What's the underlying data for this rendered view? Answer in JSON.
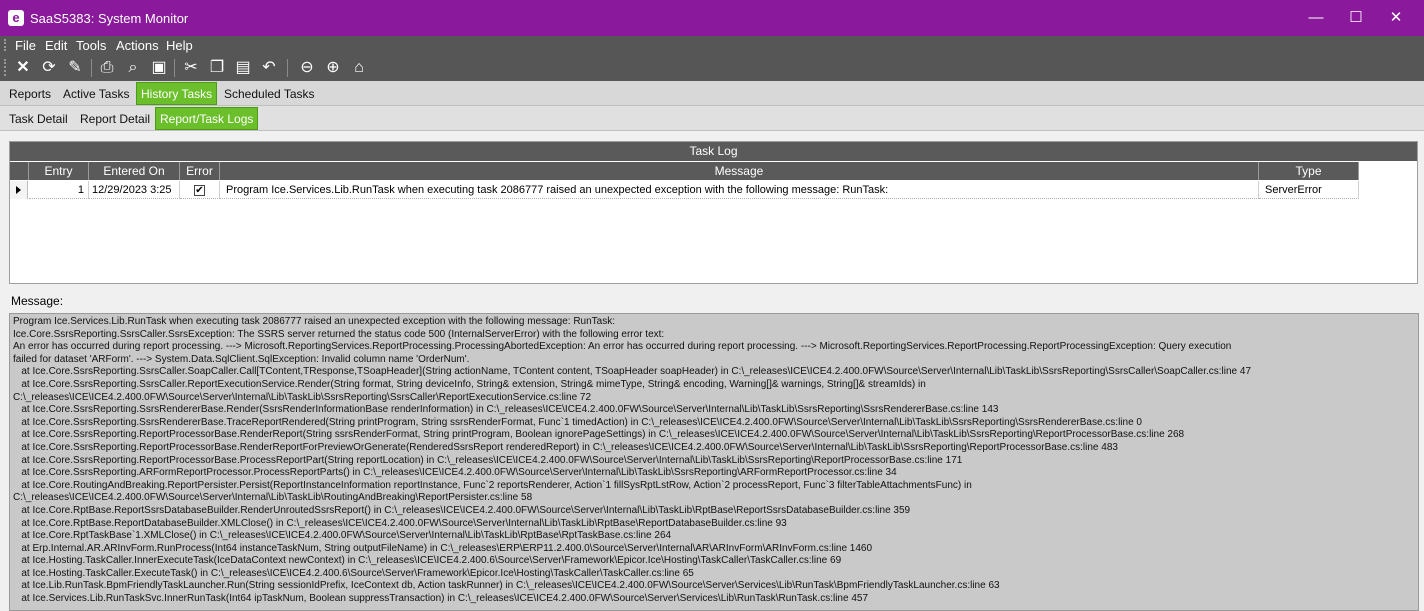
{
  "window": {
    "title": "SaaS5383: System Monitor",
    "app_icon_letter": "e",
    "controls": [
      "—",
      "☐",
      "✕"
    ]
  },
  "menu": [
    "File",
    "Edit",
    "Tools",
    "Actions",
    "Help"
  ],
  "toolbar_icons": [
    "clear-icon",
    "refresh-icon",
    "brush-icon",
    "print-icon",
    "preview-icon",
    "save-icon",
    "cut-icon",
    "copy-icon",
    "paste-icon",
    "undo-icon",
    "back-icon",
    "forward-icon",
    "home-icon"
  ],
  "tabs": {
    "main": [
      "Reports",
      "Active Tasks",
      "History Tasks",
      "Scheduled Tasks"
    ],
    "main_active": "History Tasks",
    "sub": [
      "Task Detail",
      "Report Detail",
      "Report/Task Logs"
    ],
    "sub_active": "Report/Task Logs"
  },
  "grid": {
    "caption": "Task Log",
    "columns": [
      "Entry",
      "Entered On",
      "Error",
      "Message",
      "Type"
    ],
    "rows": [
      {
        "entry": "1",
        "entered_on": "12/29/2023 3:25",
        "error": true,
        "message": "Program Ice.Services.Lib.RunTask when executing task 2086777 raised an unexpected exception with the following message: RunTask:",
        "type": "ServerError"
      }
    ]
  },
  "message_label": "Message:",
  "message_lines": [
    "Program Ice.Services.Lib.RunTask when executing task 2086777 raised an unexpected exception with the following message: RunTask:",
    "Ice.Core.SsrsReporting.SsrsCaller.SsrsException: The SSRS server returned the status code 500 (InternalServerError) with the following error text:",
    "An error has occurred during report processing. ---> Microsoft.ReportingServices.ReportProcessing.ProcessingAbortedException: An error has occurred during report processing. ---> Microsoft.ReportingServices.ReportProcessing.ReportProcessingException: Query execution",
    "failed for dataset 'ARForm'. ---> System.Data.SqlClient.SqlException: Invalid column name 'OrderNum'.",
    "   at Ice.Core.SsrsReporting.SsrsCaller.SoapCaller.Call[TContent,TResponse,TSoapHeader](String actionName, TContent content, TSoapHeader soapHeader) in C:\\_releases\\ICE\\ICE4.2.400.0FW\\Source\\Server\\Internal\\Lib\\TaskLib\\SsrsReporting\\SsrsCaller\\SoapCaller.cs:line 47",
    "   at Ice.Core.SsrsReporting.SsrsCaller.ReportExecutionService.Render(String format, String deviceInfo, String& extension, String& mimeType, String& encoding, Warning[]& warnings, String[]& streamIds) in",
    "C:\\_releases\\ICE\\ICE4.2.400.0FW\\Source\\Server\\Internal\\Lib\\TaskLib\\SsrsReporting\\SsrsCaller\\ReportExecutionService.cs:line 72",
    "   at Ice.Core.SsrsReporting.SsrsRendererBase.Render(SsrsRenderInformationBase renderInformation) in C:\\_releases\\ICE\\ICE4.2.400.0FW\\Source\\Server\\Internal\\Lib\\TaskLib\\SsrsReporting\\SsrsRendererBase.cs:line 143",
    "   at Ice.Core.SsrsReporting.SsrsRendererBase.TraceReportRendered(String printProgram, String ssrsRenderFormat, Func`1 timedAction) in C:\\_releases\\ICE\\ICE4.2.400.0FW\\Source\\Server\\Internal\\Lib\\TaskLib\\SsrsReporting\\SsrsRendererBase.cs:line 0",
    "   at Ice.Core.SsrsReporting.ReportProcessorBase.RenderReport(String ssrsRenderFormat, String printProgram, Boolean ignorePageSettings) in C:\\_releases\\ICE\\ICE4.2.400.0FW\\Source\\Server\\Internal\\Lib\\TaskLib\\SsrsReporting\\ReportProcessorBase.cs:line 268",
    "   at Ice.Core.SsrsReporting.ReportProcessorBase.RenderReportForPreviewOrGenerate(RenderedSsrsReport renderedReport) in C:\\_releases\\ICE\\ICE4.2.400.0FW\\Source\\Server\\Internal\\Lib\\TaskLib\\SsrsReporting\\ReportProcessorBase.cs:line 483",
    "   at Ice.Core.SsrsReporting.ReportProcessorBase.ProcessReportPart(String reportLocation) in C:\\_releases\\ICE\\ICE4.2.400.0FW\\Source\\Server\\Internal\\Lib\\TaskLib\\SsrsReporting\\ReportProcessorBase.cs:line 171",
    "   at Ice.Core.SsrsReporting.ARFormReportProcessor.ProcessReportParts() in C:\\_releases\\ICE\\ICE4.2.400.0FW\\Source\\Server\\Internal\\Lib\\TaskLib\\SsrsReporting\\ARFormReportProcessor.cs:line 34",
    "   at Ice.Core.RoutingAndBreaking.ReportPersister.Persist(ReportInstanceInformation reportInstance, Func`2 reportsRenderer, Action`1 fillSysRptLstRow, Action`2 processReport, Func`3 filterTableAttachmentsFunc) in",
    "C:\\_releases\\ICE\\ICE4.2.400.0FW\\Source\\Server\\Internal\\Lib\\TaskLib\\RoutingAndBreaking\\ReportPersister.cs:line 58",
    "   at Ice.Core.RptBase.ReportSsrsDatabaseBuilder.RenderUnroutedSsrsReport() in C:\\_releases\\ICE\\ICE4.2.400.0FW\\Source\\Server\\Internal\\Lib\\TaskLib\\RptBase\\ReportSsrsDatabaseBuilder.cs:line 359",
    "   at Ice.Core.RptBase.ReportDatabaseBuilder.XMLClose() in C:\\_releases\\ICE\\ICE4.2.400.0FW\\Source\\Server\\Internal\\Lib\\TaskLib\\RptBase\\ReportDatabaseBuilder.cs:line 93",
    "   at Ice.Core.RptTaskBase`1.XMLClose() in C:\\_releases\\ICE\\ICE4.2.400.0FW\\Source\\Server\\Internal\\Lib\\TaskLib\\RptBase\\RptTaskBase.cs:line 264",
    "   at Erp.Internal.AR.ARInvForm.RunProcess(Int64 instanceTaskNum, String outputFileName) in C:\\_releases\\ERP\\ERP11.2.400.0\\Source\\Server\\Internal\\AR\\ARInvForm\\ARInvForm.cs:line 1460",
    "   at Ice.Hosting.TaskCaller.InnerExecuteTask(IceDataContext newContext) in C:\\_releases\\ICE\\ICE4.2.400.6\\Source\\Server\\Framework\\Epicor.Ice\\Hosting\\TaskCaller\\TaskCaller.cs:line 69",
    "   at Ice.Hosting.TaskCaller.ExecuteTask() in C:\\_releases\\ICE\\ICE4.2.400.6\\Source\\Server\\Framework\\Epicor.Ice\\Hosting\\TaskCaller\\TaskCaller.cs:line 65",
    "   at Ice.Lib.RunTask.BpmFriendlyTaskLauncher.Run(String sessionIdPrefix, IceContext db, Action taskRunner) in C:\\_releases\\ICE\\ICE4.2.400.0FW\\Source\\Server\\Services\\Lib\\RunTask\\BpmFriendlyTaskLauncher.cs:line 63",
    "   at Ice.Services.Lib.RunTaskSvc.InnerRunTask(Int64 ipTaskNum, Boolean suppressTransaction) in C:\\_releases\\ICE\\ICE4.2.400.0FW\\Source\\Server\\Services\\Lib\\RunTask\\RunTask.cs:line 457"
  ]
}
